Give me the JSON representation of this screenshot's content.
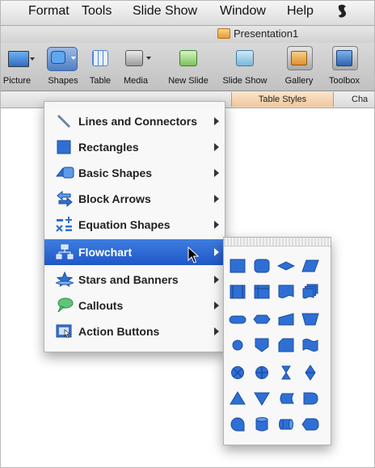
{
  "menubar": {
    "items": [
      "Format",
      "Tools",
      "Slide Show",
      "Window",
      "Help"
    ],
    "script_icon": "script-menu-icon"
  },
  "window": {
    "title": "Presentation1"
  },
  "toolbar": {
    "buttons": [
      "Picture",
      "Shapes",
      "Table",
      "Media",
      "New Slide",
      "Slide Show",
      "Gallery",
      "Toolbox"
    ]
  },
  "ribbon": {
    "tab_table_styles": "Table Styles",
    "tab_partial": "Cha"
  },
  "shapes_menu": {
    "items": [
      {
        "label": "Lines and Connectors",
        "icon": "line-icon"
      },
      {
        "label": "Rectangles",
        "icon": "rectangle-icon"
      },
      {
        "label": "Basic Shapes",
        "icon": "basic-shapes-icon"
      },
      {
        "label": "Block Arrows",
        "icon": "block-arrow-icon"
      },
      {
        "label": "Equation Shapes",
        "icon": "equation-icon"
      },
      {
        "label": "Flowchart",
        "icon": "flowchart-icon",
        "selected": true
      },
      {
        "label": "Stars and Banners",
        "icon": "star-icon"
      },
      {
        "label": "Callouts",
        "icon": "callout-icon"
      },
      {
        "label": "Action Buttons",
        "icon": "action-button-icon"
      }
    ]
  },
  "flowchart_submenu": {
    "shapes": [
      "process-shape-icon",
      "alternate-process-shape-icon",
      "decision-shape-icon",
      "data-shape-icon",
      "predefined-process-shape-icon",
      "internal-storage-shape-icon",
      "document-shape-icon",
      "multidocument-shape-icon",
      "terminator-shape-icon",
      "preparation-shape-icon",
      "manual-input-shape-icon",
      "manual-operation-shape-icon",
      "connector-shape-icon",
      "offpage-connector-shape-icon",
      "card-shape-icon",
      "punched-tape-shape-icon",
      "summing-junction-shape-icon",
      "or-shape-icon",
      "collate-shape-icon",
      "sort-shape-icon",
      "extract-shape-icon",
      "merge-shape-icon",
      "stored-data-shape-icon",
      "delay-shape-icon",
      "sequential-access-storage-shape-icon",
      "magnetic-disk-shape-icon",
      "direct-access-storage-shape-icon",
      "display-shape-icon"
    ],
    "fill_color": "#2f6fd3",
    "stroke_color": "#1a4da3"
  }
}
